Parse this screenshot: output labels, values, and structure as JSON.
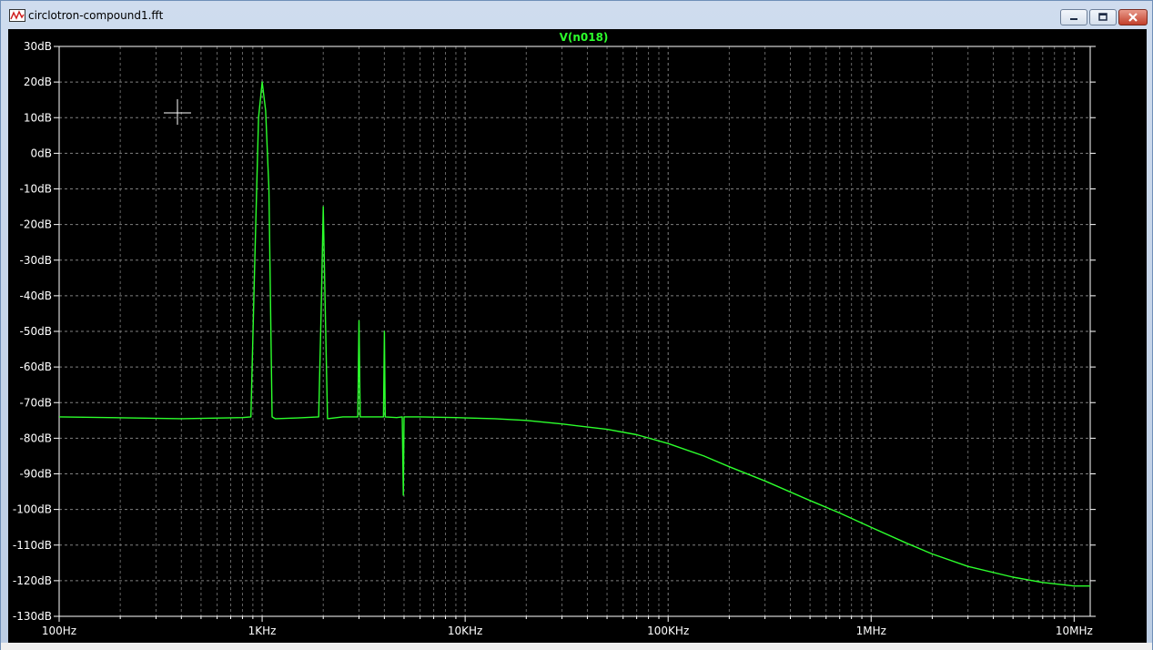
{
  "window": {
    "title": "circlotron-compound1.fft",
    "icon": "waveform-plot-icon",
    "controls": [
      "minimize-icon",
      "maximize-icon",
      "close-icon"
    ]
  },
  "colors": {
    "background": "#000000",
    "grid": "#808080",
    "trace": "#2cff2c",
    "axis_text": "#ffffff",
    "title_text": "#2cff2c"
  },
  "chart_data": {
    "type": "line",
    "title": "V(n018)",
    "x_scale": "log",
    "xlim": [
      100,
      12000000
    ],
    "ylim": [
      -130,
      30
    ],
    "x_ticks": [
      {
        "v": 100,
        "label": "100Hz"
      },
      {
        "v": 1000,
        "label": "1KHz"
      },
      {
        "v": 10000,
        "label": "10KHz"
      },
      {
        "v": 100000,
        "label": "100KHz"
      },
      {
        "v": 1000000,
        "label": "1MHz"
      },
      {
        "v": 10000000,
        "label": "10MHz"
      }
    ],
    "y_ticks": [
      {
        "v": 30,
        "label": "30dB"
      },
      {
        "v": 20,
        "label": "20dB"
      },
      {
        "v": 10,
        "label": "10dB"
      },
      {
        "v": 0,
        "label": "0dB"
      },
      {
        "v": -10,
        "label": "-10dB"
      },
      {
        "v": -20,
        "label": "-20dB"
      },
      {
        "v": -30,
        "label": "-30dB"
      },
      {
        "v": -40,
        "label": "-40dB"
      },
      {
        "v": -50,
        "label": "-50dB"
      },
      {
        "v": -60,
        "label": "-60dB"
      },
      {
        "v": -70,
        "label": "-70dB"
      },
      {
        "v": -80,
        "label": "-80dB"
      },
      {
        "v": -90,
        "label": "-90dB"
      },
      {
        "v": -100,
        "label": "-100dB"
      },
      {
        "v": -110,
        "label": "-110dB"
      },
      {
        "v": -120,
        "label": "-120dB"
      },
      {
        "v": -130,
        "label": "-130dB"
      }
    ],
    "grid": true,
    "grid_style": "dashed",
    "series": [
      {
        "name": "V(n018)",
        "x": [
          100,
          400,
          800,
          880,
          920,
          960,
          1000,
          1040,
          1080,
          1120,
          1160,
          1500,
          1900,
          1960,
          2000,
          2040,
          2100,
          2500,
          2960,
          3000,
          3040,
          3500,
          3960,
          4000,
          4040,
          4600,
          4900,
          4960,
          5000,
          5040,
          5100,
          6000,
          9000,
          14000,
          20000,
          30000,
          50000,
          70000,
          100000,
          150000,
          200000,
          300000,
          500000,
          700000,
          1000000,
          1500000,
          2000000,
          3000000,
          5000000,
          7000000,
          10000000,
          12000000
        ],
        "y": [
          -74,
          -74.5,
          -74.2,
          -74,
          -30,
          10,
          20,
          12,
          -10,
          -74,
          -74.5,
          -74.3,
          -74,
          -40,
          -15,
          -40,
          -74.5,
          -74,
          -74,
          -47,
          -74,
          -74,
          -74,
          -50,
          -74,
          -74.2,
          -74,
          -96,
          -74,
          -74,
          -74,
          -74,
          -74.2,
          -74.5,
          -75,
          -76,
          -77.5,
          -79,
          -81.5,
          -85,
          -88,
          -92,
          -97.5,
          -101,
          -105,
          -109.5,
          -112.5,
          -116,
          -119,
          -120.5,
          -121.5,
          -121.5
        ]
      }
    ]
  }
}
